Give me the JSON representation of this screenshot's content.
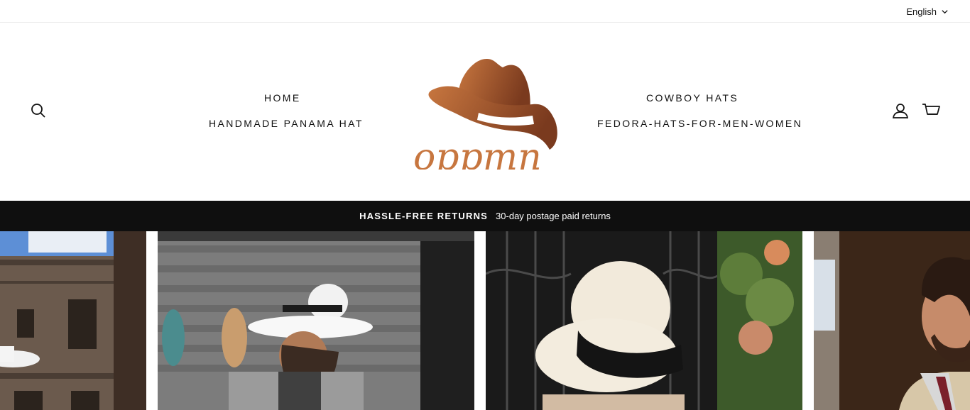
{
  "utility": {
    "language": "English"
  },
  "header": {
    "nav_left": [
      {
        "label": "HOME"
      },
      {
        "label": "HANDMADE PANAMA HAT"
      }
    ],
    "nav_right": [
      {
        "label": "COWBOY HATS"
      },
      {
        "label": "FEDORA-HATS-FOR-MEN-WOMEN"
      }
    ],
    "logo_text": "oppmn",
    "icons": {
      "search": "search-icon",
      "account": "user-icon",
      "cart": "cart-icon"
    }
  },
  "announcement": {
    "title": "HASSLE-FREE RETURNS",
    "text": "30-day postage paid returns"
  },
  "colors": {
    "logo_brown_dark": "#7a3a1e",
    "logo_brown_light": "#c7763f",
    "announce_bg": "#0f0f0f"
  }
}
